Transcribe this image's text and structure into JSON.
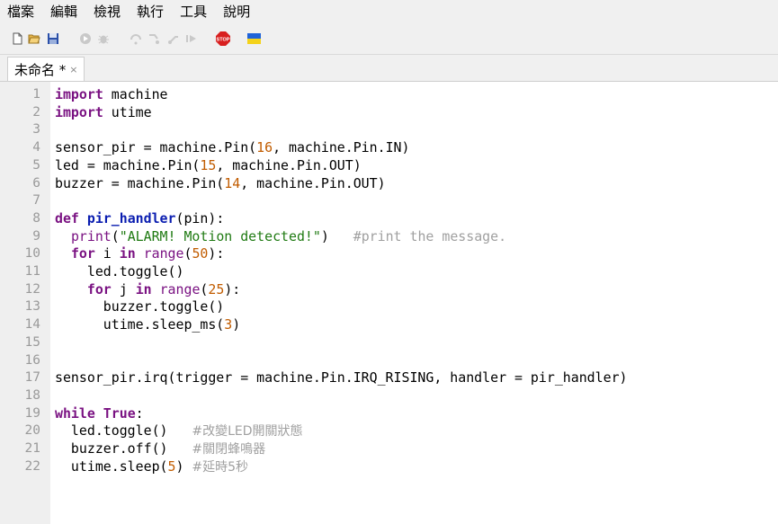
{
  "menu": [
    "檔案",
    "編輯",
    "檢視",
    "執行",
    "工具",
    "說明"
  ],
  "tab": {
    "title": "未命名 *",
    "close": "×"
  },
  "toolbar": {
    "icons": [
      "new-file-icon",
      "open-folder-icon",
      "save-icon",
      "run-icon",
      "debug-icon",
      "step-over-icon",
      "step-into-icon",
      "step-out-icon",
      "resume-icon",
      "stop-icon",
      "ukraine-flag-icon"
    ],
    "stop_label": "STOP"
  },
  "colors": {
    "keyword": "#7a1282",
    "function_def": "#0a1db0",
    "number": "#c15c00",
    "string": "#1f7a12",
    "comment": "#a0a0a0"
  },
  "editor": {
    "line_numbers": [
      "1",
      "2",
      "3",
      "4",
      "5",
      "6",
      "7",
      "8",
      "9",
      "10",
      "11",
      "12",
      "13",
      "14",
      "15",
      "16",
      "17",
      "18",
      "19",
      "20",
      "21",
      "22"
    ],
    "lines": [
      [
        {
          "t": "import",
          "c": "kw"
        },
        {
          "t": " machine"
        }
      ],
      [
        {
          "t": "import",
          "c": "kw"
        },
        {
          "t": " utime"
        }
      ],
      [],
      [
        {
          "t": "sensor_pir = machine.Pin("
        },
        {
          "t": "16",
          "c": "num"
        },
        {
          "t": ", machine.Pin.IN)"
        }
      ],
      [
        {
          "t": "led = machine.Pin("
        },
        {
          "t": "15",
          "c": "num"
        },
        {
          "t": ", machine.Pin.OUT)"
        }
      ],
      [
        {
          "t": "buzzer = machine.Pin("
        },
        {
          "t": "14",
          "c": "num"
        },
        {
          "t": ", machine.Pin.OUT)"
        }
      ],
      [],
      [
        {
          "t": "def",
          "c": "kw"
        },
        {
          "t": " "
        },
        {
          "t": "pir_handler",
          "c": "fn"
        },
        {
          "t": "(pin):"
        }
      ],
      [
        {
          "t": "  "
        },
        {
          "t": "print",
          "c": "bi"
        },
        {
          "t": "("
        },
        {
          "t": "\"ALARM! Motion detected!\"",
          "c": "str"
        },
        {
          "t": ")   "
        },
        {
          "t": "#print the message.",
          "c": "cmt"
        }
      ],
      [
        {
          "t": "  "
        },
        {
          "t": "for",
          "c": "kw"
        },
        {
          "t": " i "
        },
        {
          "t": "in",
          "c": "kw"
        },
        {
          "t": " "
        },
        {
          "t": "range",
          "c": "bi"
        },
        {
          "t": "("
        },
        {
          "t": "50",
          "c": "num"
        },
        {
          "t": "):"
        }
      ],
      [
        {
          "t": "    led.toggle()"
        }
      ],
      [
        {
          "t": "    "
        },
        {
          "t": "for",
          "c": "kw"
        },
        {
          "t": " j "
        },
        {
          "t": "in",
          "c": "kw"
        },
        {
          "t": " "
        },
        {
          "t": "range",
          "c": "bi"
        },
        {
          "t": "("
        },
        {
          "t": "25",
          "c": "num"
        },
        {
          "t": "):"
        }
      ],
      [
        {
          "t": "      buzzer.toggle()"
        }
      ],
      [
        {
          "t": "      utime.sleep_ms("
        },
        {
          "t": "3",
          "c": "num"
        },
        {
          "t": ")"
        }
      ],
      [],
      [],
      [
        {
          "t": "sensor_pir.irq(trigger = machine.Pin.IRQ_RISING, handler = pir_handler)"
        }
      ],
      [],
      [
        {
          "t": "while",
          "c": "kw"
        },
        {
          "t": " "
        },
        {
          "t": "True",
          "c": "kw"
        },
        {
          "t": ":"
        }
      ],
      [
        {
          "t": "  led.toggle()   "
        },
        {
          "t": "#改變LED開關狀態",
          "c": "cmt-cjk"
        }
      ],
      [
        {
          "t": "  buzzer.off()   "
        },
        {
          "t": "#關閉蜂鳴器",
          "c": "cmt-cjk"
        }
      ],
      [
        {
          "t": "  utime.sleep("
        },
        {
          "t": "5",
          "c": "num"
        },
        {
          "t": ") "
        },
        {
          "t": "#延時5秒",
          "c": "cmt-cjk"
        }
      ]
    ]
  }
}
